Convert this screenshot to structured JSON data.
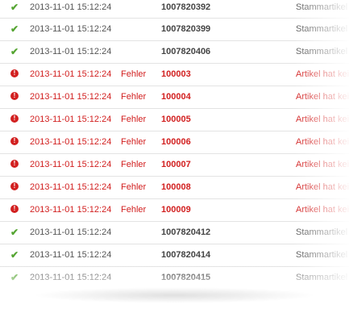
{
  "log": {
    "rows": [
      {
        "status": "ok",
        "icon": "check-icon",
        "date": "2013-11-01 15:12:24",
        "label": "",
        "id": "1007820392",
        "message": "Stammartikel vo"
      },
      {
        "status": "ok",
        "icon": "check-icon",
        "date": "2013-11-01 15:12:24",
        "label": "",
        "id": "1007820399",
        "message": "Stammartikel vo"
      },
      {
        "status": "ok",
        "icon": "check-icon",
        "date": "2013-11-01 15:12:24",
        "label": "",
        "id": "1007820406",
        "message": "Stammartikel vo"
      },
      {
        "status": "error",
        "icon": "alert-icon",
        "date": "2013-11-01 15:12:24",
        "label": "Fehler",
        "id": "100003",
        "message": "Artikel hat keine"
      },
      {
        "status": "error",
        "icon": "alert-icon",
        "date": "2013-11-01 15:12:24",
        "label": "Fehler",
        "id": "100004",
        "message": "Artikel hat keine"
      },
      {
        "status": "error",
        "icon": "alert-icon",
        "date": "2013-11-01 15:12:24",
        "label": "Fehler",
        "id": "100005",
        "message": "Artikel hat keine"
      },
      {
        "status": "error",
        "icon": "alert-icon",
        "date": "2013-11-01 15:12:24",
        "label": "Fehler",
        "id": "100006",
        "message": "Artikel hat keine"
      },
      {
        "status": "error",
        "icon": "alert-icon",
        "date": "2013-11-01 15:12:24",
        "label": "Fehler",
        "id": "100007",
        "message": "Artikel hat keine"
      },
      {
        "status": "error",
        "icon": "alert-icon",
        "date": "2013-11-01 15:12:24",
        "label": "Fehler",
        "id": "100008",
        "message": "Artikel hat keine"
      },
      {
        "status": "error",
        "icon": "alert-icon",
        "date": "2013-11-01 15:12:24",
        "label": "Fehler",
        "id": "100009",
        "message": "Artikel hat keine"
      },
      {
        "status": "ok",
        "icon": "check-icon",
        "date": "2013-11-01 15:12:24",
        "label": "",
        "id": "1007820412",
        "message": "Stammartikel vo"
      },
      {
        "status": "ok",
        "icon": "check-icon",
        "date": "2013-11-01 15:12:24",
        "label": "",
        "id": "1007820414",
        "message": "Stammartikel vo"
      },
      {
        "status": "ok",
        "icon": "check-icon",
        "date": "2013-11-01 15:12:24",
        "label": "",
        "id": "1007820415",
        "message": "Stammartikel vo"
      }
    ]
  },
  "colors": {
    "success": "#55a532",
    "error": "#d22020",
    "text": "#555555"
  }
}
